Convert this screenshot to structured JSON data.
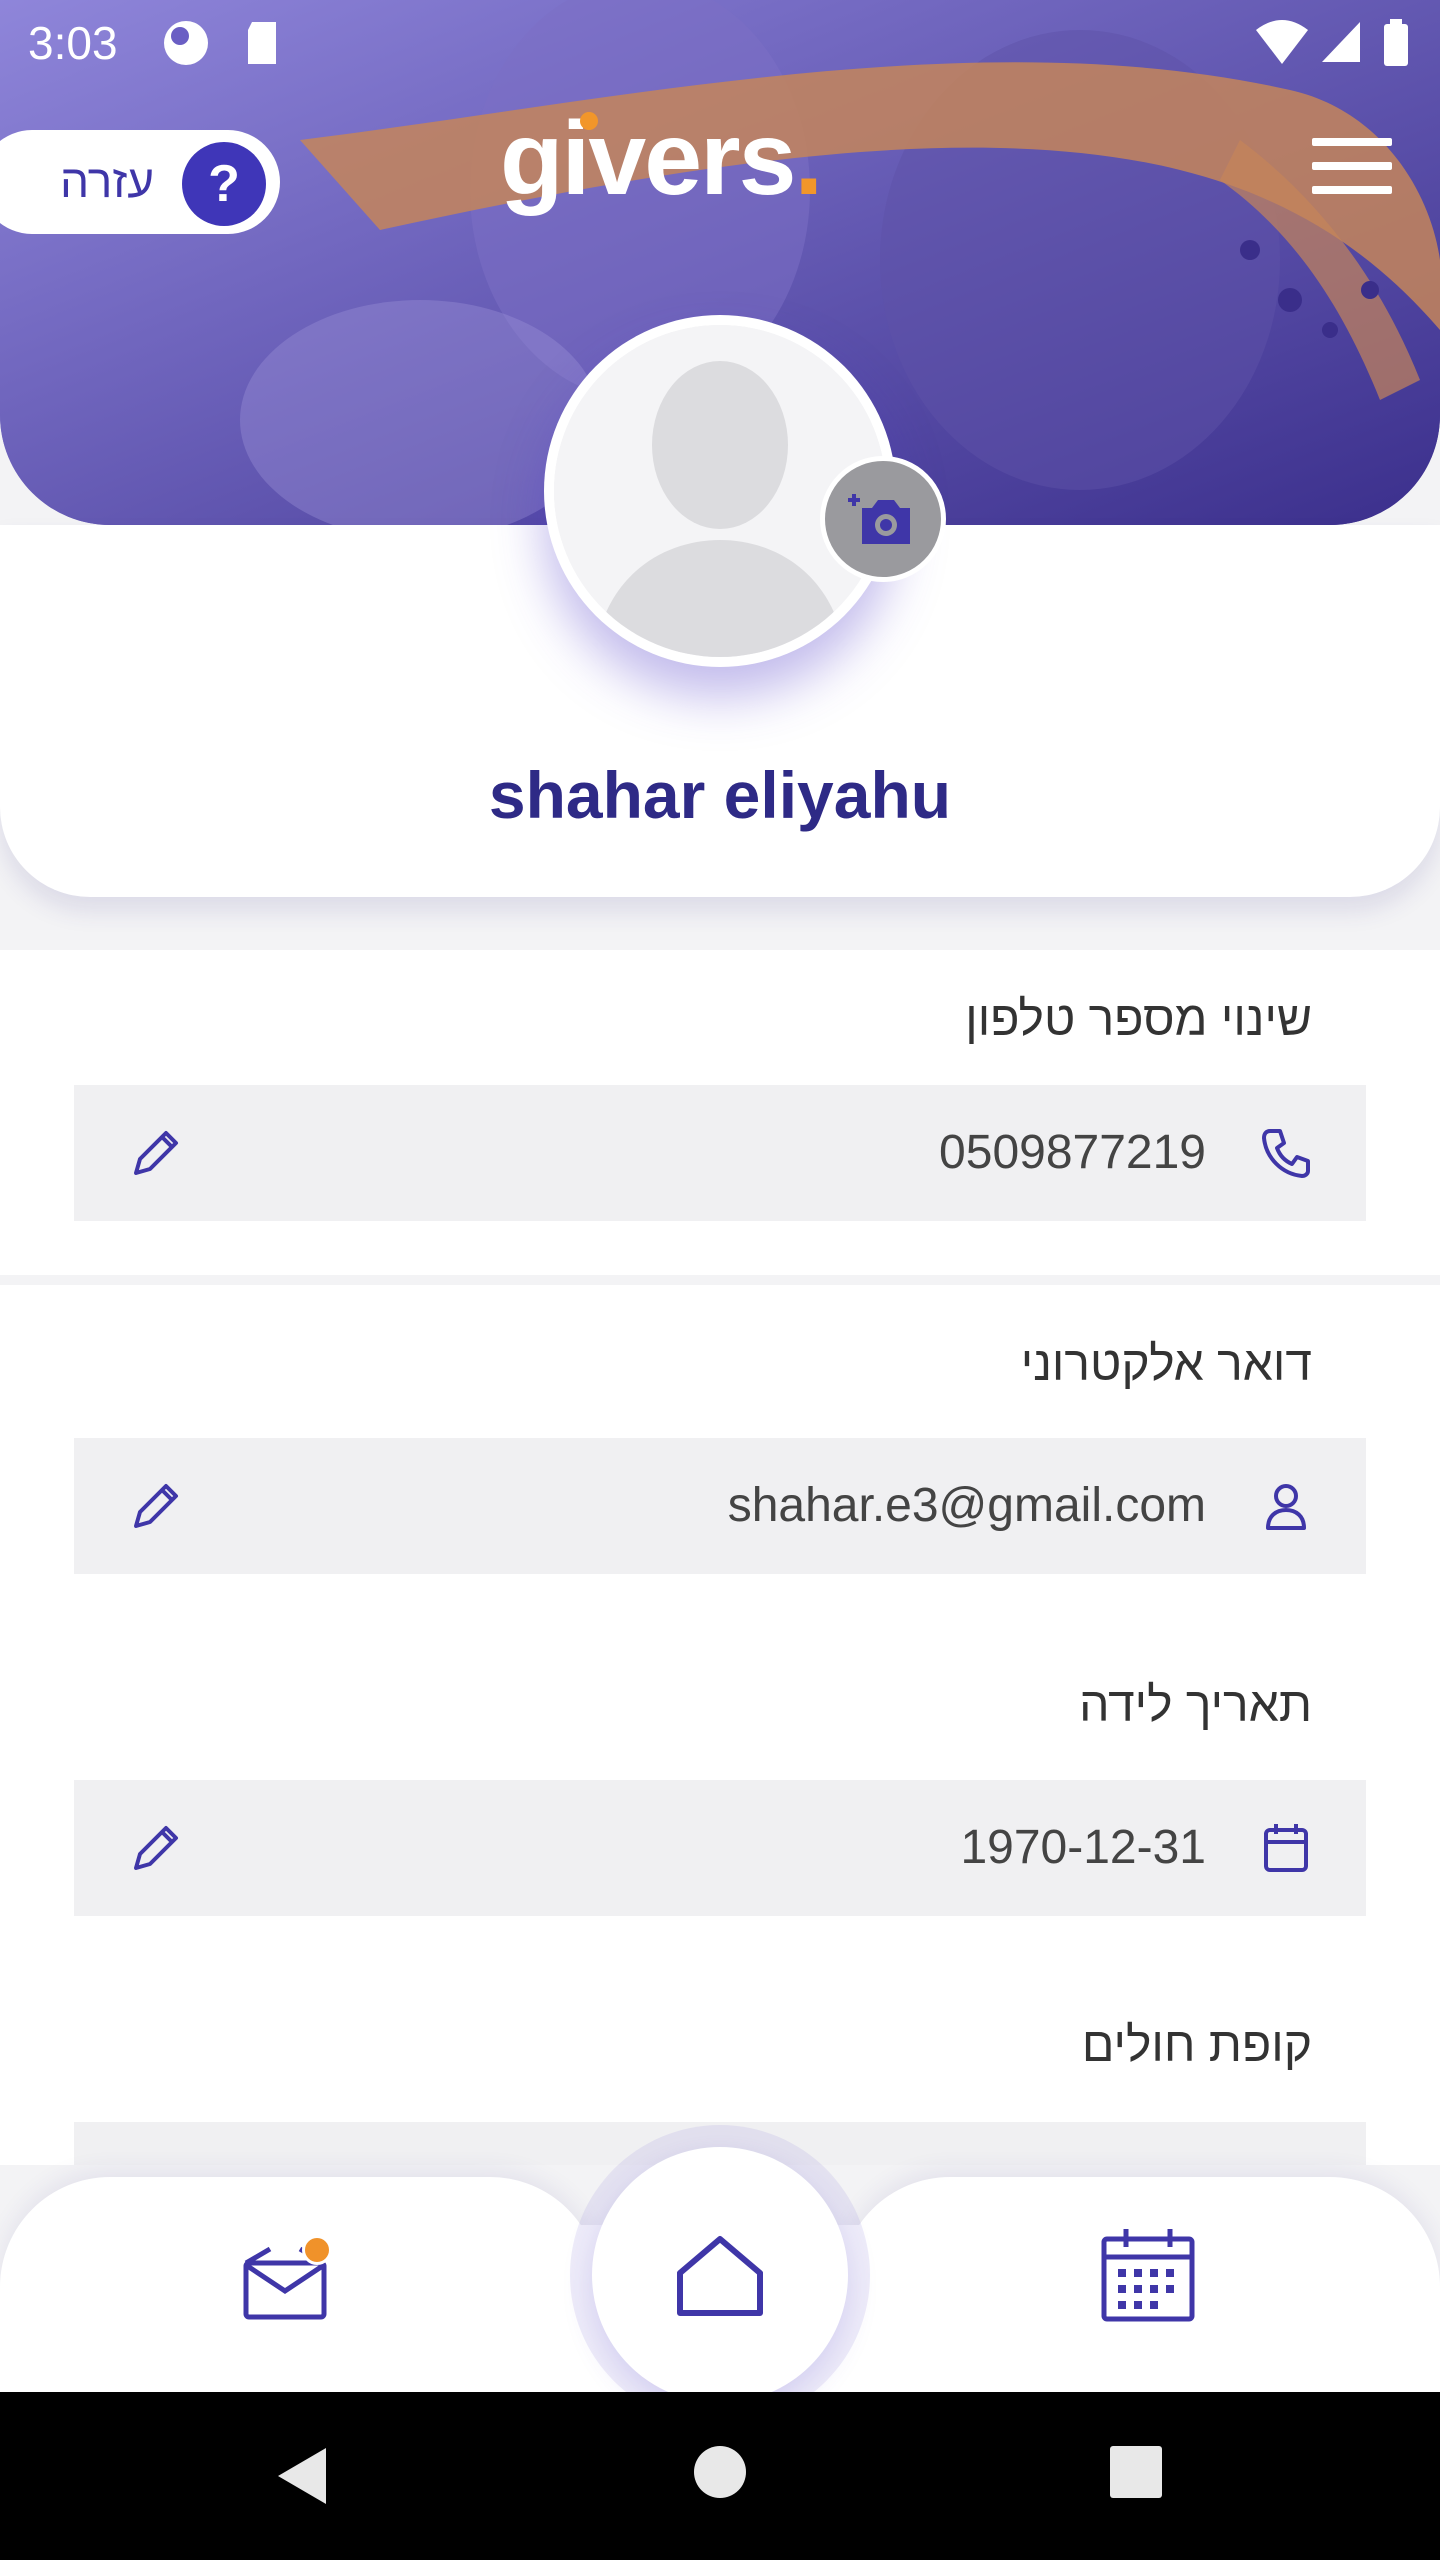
{
  "statusbar": {
    "time": "3:03"
  },
  "header": {
    "help_label": "עזרה",
    "help_symbol": "?",
    "logo_text": "givers",
    "logo_dot": "."
  },
  "profile": {
    "name": "shahar eliyahu"
  },
  "fields": [
    {
      "label": "שינוי מספר טלפון",
      "value": "0509877219",
      "icon": "phone-icon"
    },
    {
      "label": "דואר אלקטרוני",
      "value": "shahar.e3@gmail.com",
      "icon": "user-icon"
    },
    {
      "label": "תאריך לידה",
      "value": "1970-12-31",
      "icon": "calendar-icon"
    },
    {
      "label": "קופת חולים",
      "value": "",
      "icon": "clipboard-icon"
    }
  ],
  "colors": {
    "brand": "#3f36b8",
    "accent": "#f2962a",
    "name": "#2e2a86"
  },
  "nav": {
    "items": [
      "inbox-icon",
      "home-icon",
      "calendar-icon"
    ]
  }
}
